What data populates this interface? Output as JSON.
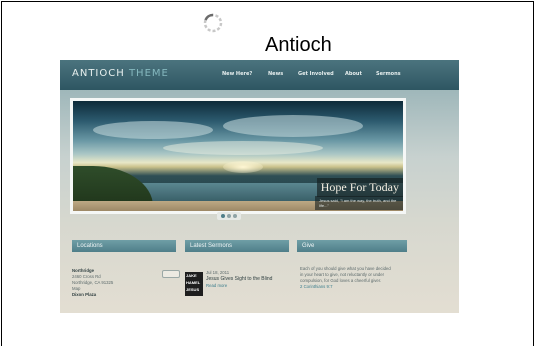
{
  "page": {
    "title": "Antioch"
  },
  "screenshot": {
    "logo_main": "ANTIOCH",
    "logo_accent": "THEME",
    "nav": [
      "New Here?",
      "News",
      "Get Involved",
      "About",
      "Sermons"
    ],
    "hero": {
      "caption": "Hope For Today",
      "subcaption": "Jesus said, \"I am the way, the truth, and the life...\""
    },
    "columns": [
      {
        "heading": "Locations",
        "lines": [
          "Northridge",
          "2460 Cross Rd",
          "Northridge, CA 91325",
          "Map",
          "Dixon Plaza"
        ]
      },
      {
        "heading": "Latest Sermons",
        "date": "Jul 18, 2011",
        "sermon_title": "Jesus Gives Sight to the Blind",
        "more": "Read more",
        "thumb_text": [
          "JAKE",
          "HAMEL",
          "JESUS"
        ]
      },
      {
        "heading": "Give",
        "lines": [
          "Each of you should give what you have decided",
          "in your heart to give, not reluctantly or under",
          "compulsion, for God loves a cheerful giver."
        ],
        "link": "2 Corinthians 9:7"
      }
    ]
  },
  "colors": {
    "topbar": "#2e5662",
    "accent": "#85b8bf",
    "column_head": "#5f8e98"
  }
}
